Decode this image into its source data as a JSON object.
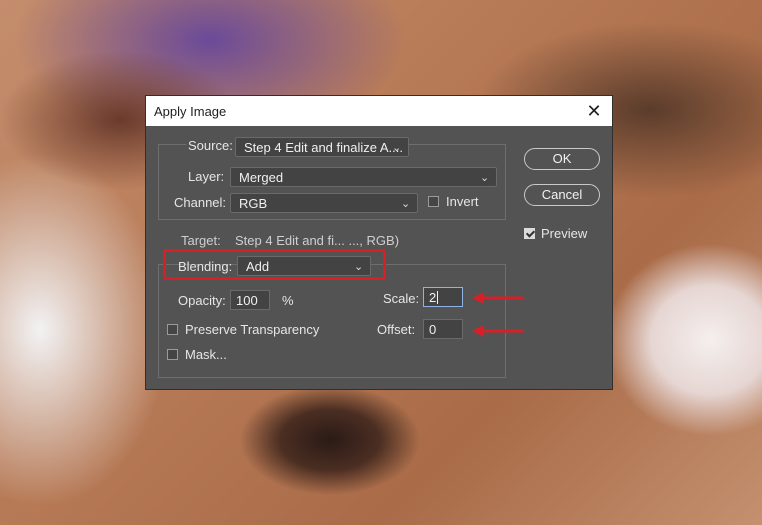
{
  "dialog": {
    "title": "Apply Image",
    "close_glyph": "✕",
    "source": {
      "label": "Source:",
      "value": "Step 4 Edit and finalize A...."
    },
    "layer": {
      "label": "Layer:",
      "value": "Merged"
    },
    "channel": {
      "label": "Channel:",
      "value": "RGB"
    },
    "invert": {
      "label": "Invert",
      "checked": false
    },
    "target": {
      "label": "Target:",
      "value": "Step 4 Edit and fi... ..., RGB)"
    },
    "blending": {
      "label": "Blending:",
      "value": "Add"
    },
    "opacity": {
      "label": "Opacity:",
      "value": "100",
      "unit": "%"
    },
    "scale": {
      "label": "Scale:",
      "value": "2"
    },
    "offset": {
      "label": "Offset:",
      "value": "0"
    },
    "preserve_transparency": {
      "label": "Preserve Transparency",
      "checked": false
    },
    "mask": {
      "label": "Mask...",
      "checked": false
    },
    "buttons": {
      "ok": "OK",
      "cancel": "Cancel"
    },
    "preview": {
      "label": "Preview",
      "checked": true
    }
  },
  "annotations": {
    "highlight_color": "#d61f26",
    "arrow_color": "#d61f26"
  },
  "icons": {
    "chevron": "chevron-down-icon",
    "close": "close-icon"
  }
}
